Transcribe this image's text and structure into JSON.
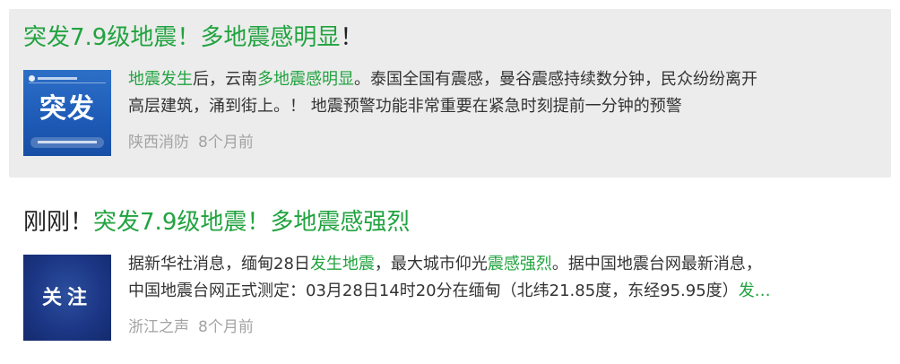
{
  "articles": [
    {
      "title": {
        "prefix": "",
        "hl1": "突发7.9级地震！多地震感明显",
        "suffix": "！"
      },
      "thumb": {
        "text": "突发"
      },
      "snippet": {
        "l1a": "地震发生",
        "l1b": "后，云南",
        "l1c": "多地震感明显",
        "l1d": "。泰国全国有震感，曼谷震感持续数分钟，民众纷纷离开",
        "l2": "高层建筑，涌到街上。！ 地震预警功能非常重要在紧急时刻提前一分钟的预警"
      },
      "source": "陕西消防",
      "time": "8个月前"
    },
    {
      "title": {
        "prefix": "刚刚！",
        "hl1": "突发7.9级地震！多地震感强烈",
        "suffix": ""
      },
      "thumb": {
        "text": "关注"
      },
      "snippet": {
        "l1a": "据新华社消息，缅甸28日",
        "l1b": "发生地震",
        "l1c": "，最大城市仰光",
        "l1d": "震感强烈",
        "l1e": "。据中国地震台网最新消息，",
        "l2a": "中国地震台网正式测定：03月28日14时20分在缅甸（北纬21.85度，东经95.95度）",
        "l2b": "发…"
      },
      "source": "浙江之声",
      "time": "8个月前"
    }
  ],
  "colors": {
    "highlight": "#21a33f",
    "card1_bg": "#ececec",
    "meta": "#a3a3a3"
  }
}
